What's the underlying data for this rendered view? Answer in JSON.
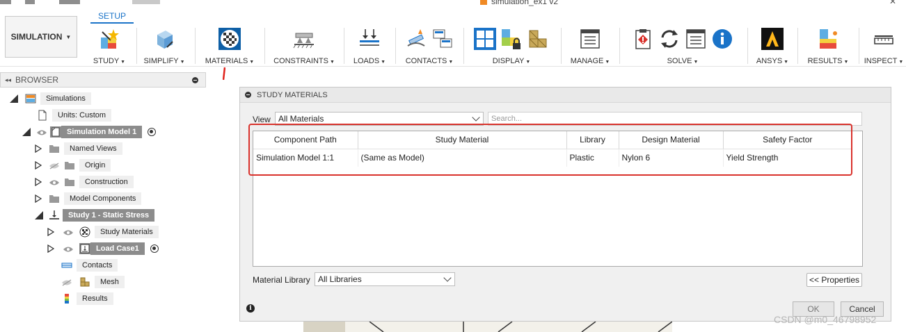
{
  "window": {
    "doc_title": "simulation_ex1 v2"
  },
  "toolbar": {
    "workspace": "SIMULATION",
    "active_tab": "SETUP",
    "groups": [
      {
        "label": "STUDY"
      },
      {
        "label": "SIMPLIFY"
      },
      {
        "label": "MATERIALS"
      },
      {
        "label": "CONSTRAINTS"
      },
      {
        "label": "LOADS"
      },
      {
        "label": "CONTACTS"
      },
      {
        "label": "DISPLAY"
      },
      {
        "label": "MANAGE"
      },
      {
        "label": "SOLVE"
      },
      {
        "label": "ANSYS"
      },
      {
        "label": "RESULTS"
      },
      {
        "label": "INSPECT"
      }
    ]
  },
  "browser": {
    "title": "BROWSER",
    "nodes": [
      {
        "label": "Simulations"
      },
      {
        "label": "Units: Custom"
      },
      {
        "label": "Simulation Model 1"
      },
      {
        "label": "Named Views"
      },
      {
        "label": "Origin"
      },
      {
        "label": "Construction"
      },
      {
        "label": "Model Components"
      },
      {
        "label": "Study 1 - Static Stress"
      },
      {
        "label": "Study Materials"
      },
      {
        "label": "Load Case1"
      },
      {
        "label": "Contacts"
      },
      {
        "label": "Mesh"
      },
      {
        "label": "Results"
      }
    ]
  },
  "dialog": {
    "title": "STUDY MATERIALS",
    "view_label": "View",
    "view_value": "All Materials",
    "search_placeholder": "Search...",
    "columns": [
      "Component Path",
      "Study Material",
      "Library",
      "Design Material",
      "Safety Factor"
    ],
    "rows": [
      [
        "Simulation Model 1:1",
        "(Same as Model)",
        "Plastic",
        "Nylon 6",
        "Yield Strength"
      ]
    ],
    "material_library_label": "Material Library",
    "material_library_value": "All Libraries",
    "properties_button": "<< Properties",
    "ok_button": "OK",
    "cancel_button": "Cancel"
  },
  "watermark": "CSDN @m0_46798952",
  "colors": {
    "accent_blue": "#1a73c8",
    "highlight_red": "#d9312b",
    "dark_node": "#8c8c8c"
  }
}
